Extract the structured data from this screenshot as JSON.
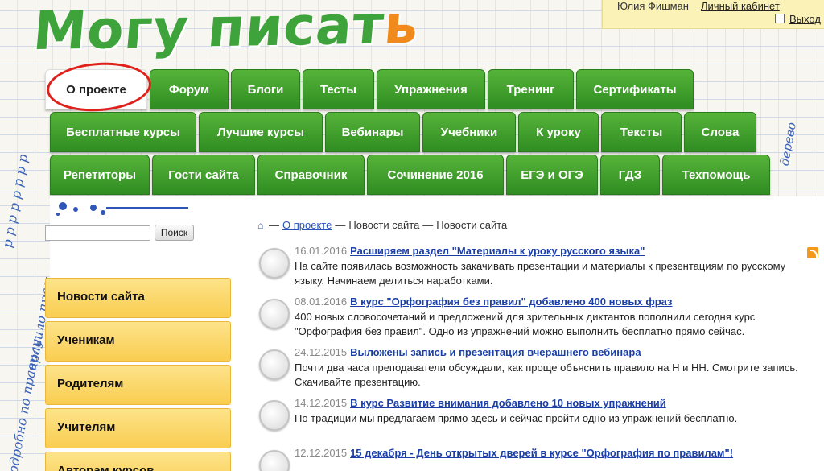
{
  "logo": {
    "main": "Могу писат",
    "accent": "ь"
  },
  "user": {
    "name": "Юлия Фишман",
    "cabinet": "Личный кабинет",
    "logout": "Выход"
  },
  "nav": {
    "row1": [
      "О проекте",
      "Форум",
      "Блоги",
      "Тесты",
      "Упражнения",
      "Тренинг",
      "Сертификаты"
    ],
    "row2": [
      "Бесплатные курсы",
      "Лучшие курсы",
      "Вебинары",
      "Учебники",
      "К уроку",
      "Тексты",
      "Слова"
    ],
    "row3": [
      "Репетиторы",
      "Гости сайта",
      "Справочник",
      "Сочинение 2016",
      "ЕГЭ и ОГЭ",
      "ГДЗ",
      "Техпомощь"
    ]
  },
  "search": {
    "placeholder": "",
    "button": "Поиск"
  },
  "sidebar": {
    "items": [
      "Новости сайта",
      "Ученикам",
      "Родителям",
      "Учителям",
      "Авторам курсов"
    ]
  },
  "breadcrumb": {
    "link": "О проекте",
    "sep1": "—",
    "item1": "Новости сайта",
    "sep2": "—",
    "item2": "Новости сайта"
  },
  "news": [
    {
      "date": "16.01.2016",
      "title": "Расширяем раздел \"Материалы к уроку русского языка\"",
      "text": "На сайте появилась возможность закачивать презентации и материалы к презентациям по русскому языку. Начинаем делиться наработками."
    },
    {
      "date": "08.01.2016",
      "title": "В курс \"Орфография без правил\" добавлено 400 новых фраз",
      "text": "400 новых словосочетаний и предложений для зрительных диктантов пополнили сегодня курс \"Орфография без правил\". Одно из упражнений можно выполнить бесплатно прямо сейчас."
    },
    {
      "date": "24.12.2015",
      "title": "Выложены запись и презентация вчерашнего вебинара",
      "text": "Почти два часа преподаватели обсуждали, как проще объяснить правило на Н и НН. Смотрите запись. Скачивайте презентацию."
    },
    {
      "date": "14.12.2015",
      "title": "В курс Развитие внимания добавлено 10 новых упражнений",
      "text": "По традиции мы предлагаем прямо здесь и сейчас пройти одно из упражнений бесплатно."
    },
    {
      "date": "12.12.2015",
      "title": "15 декабря - День открытых дверей в курсе \"Орфография по правилам\"!",
      "text": ""
    }
  ],
  "colors": {
    "tab_green": "#3d9e2c",
    "sidebar_yellow": "#fbd65f",
    "link_blue": "#1b3fa8",
    "highlight_red": "#e0201a"
  }
}
